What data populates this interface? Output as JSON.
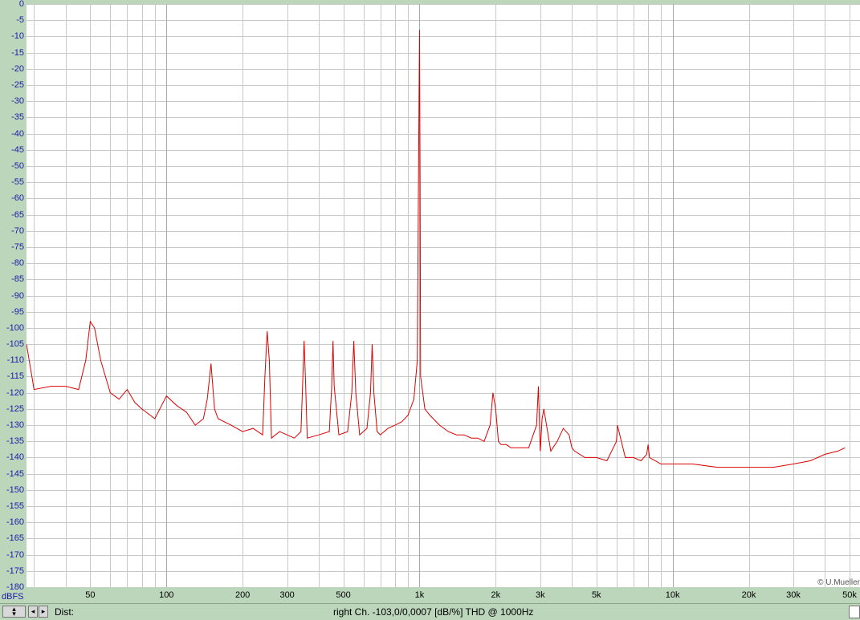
{
  "chart_data": {
    "type": "line",
    "title": "",
    "xlabel": "",
    "ylabel": "",
    "y_unit_label": "dBFS",
    "x_scale": "log",
    "xlim": [
      28,
      55000
    ],
    "ylim": [
      -180,
      0
    ],
    "grid": true,
    "y_ticks": [
      "0",
      "-5",
      "-10",
      "-15",
      "-20",
      "-25",
      "-30",
      "-35",
      "-40",
      "-45",
      "-50",
      "-55",
      "-60",
      "-65",
      "-70",
      "-75",
      "-80",
      "-85",
      "-90",
      "-95",
      "-100",
      "-105",
      "-110",
      "-115",
      "-120",
      "-125",
      "-130",
      "-135",
      "-140",
      "-145",
      "-150",
      "-155",
      "-160",
      "-165",
      "-170",
      "-175",
      "-180"
    ],
    "x_tick_labels": [
      {
        "value": 50,
        "label": "50"
      },
      {
        "value": 100,
        "label": "100"
      },
      {
        "value": 200,
        "label": "200"
      },
      {
        "value": 300,
        "label": "300"
      },
      {
        "value": 500,
        "label": "500"
      },
      {
        "value": 1000,
        "label": "1k"
      },
      {
        "value": 2000,
        "label": "2k"
      },
      {
        "value": 3000,
        "label": "3k"
      },
      {
        "value": 5000,
        "label": "5k"
      },
      {
        "value": 10000,
        "label": "10k"
      },
      {
        "value": 20000,
        "label": "20k"
      },
      {
        "value": 30000,
        "label": "30k"
      },
      {
        "value": 50000,
        "label": "50k"
      }
    ],
    "series": [
      {
        "color": "#dd0000",
        "x": [
          28,
          30,
          35,
          40,
          45,
          48,
          50,
          52,
          55,
          60,
          65,
          70,
          75,
          80,
          90,
          100,
          110,
          120,
          130,
          140,
          145,
          150,
          155,
          160,
          180,
          200,
          220,
          240,
          245,
          250,
          255,
          260,
          280,
          300,
          320,
          340,
          345,
          350,
          355,
          360,
          400,
          440,
          450,
          455,
          460,
          480,
          520,
          540,
          550,
          560,
          580,
          620,
          640,
          650,
          660,
          680,
          700,
          750,
          800,
          850,
          900,
          950,
          980,
          1000,
          1005,
          1010,
          1030,
          1050,
          1100,
          1200,
          1300,
          1400,
          1500,
          1600,
          1700,
          1800,
          1900,
          1950,
          2000,
          2050,
          2100,
          2200,
          2300,
          2500,
          2700,
          2900,
          2950,
          3000,
          3050,
          3100,
          3300,
          3500,
          3700,
          3900,
          4000,
          4100,
          4500,
          5000,
          5500,
          6000,
          6050,
          6500,
          7000,
          7500,
          7900,
          8000,
          8100,
          9000,
          10000,
          12000,
          15000,
          20000,
          25000,
          30000,
          35000,
          40000,
          45000,
          48000
        ],
        "y": [
          -105,
          -119,
          -118,
          -118,
          -119,
          -110,
          -98,
          -100,
          -110,
          -120,
          -122,
          -119,
          -123,
          -125,
          -128,
          -121,
          -124,
          -126,
          -130,
          -128,
          -122,
          -111,
          -125,
          -128,
          -130,
          -132,
          -131,
          -133,
          -115,
          -101,
          -110,
          -134,
          -132,
          -133,
          -134,
          -132,
          -118,
          -104,
          -118,
          -134,
          -133,
          -132,
          -118,
          -104,
          -118,
          -133,
          -132,
          -120,
          -104,
          -120,
          -133,
          -131,
          -120,
          -105,
          -120,
          -132,
          -133,
          -131,
          -130,
          -129,
          -127,
          -122,
          -110,
          -8,
          -50,
          -115,
          -120,
          -125,
          -127,
          -130,
          -132,
          -133,
          -133,
          -134,
          -134,
          -135,
          -130,
          -120,
          -125,
          -135,
          -136,
          -136,
          -137,
          -137,
          -137,
          -130,
          -118,
          -138,
          -128,
          -125,
          -138,
          -135,
          -131,
          -133,
          -137,
          -138,
          -140,
          -140,
          -141,
          -135,
          -130,
          -140,
          -140,
          -141,
          -139,
          -136,
          -140,
          -142,
          -142,
          -142,
          -143,
          -143,
          -143,
          -142,
          -141,
          -139,
          -138,
          -137
        ]
      }
    ]
  },
  "copyright": "© U.Mueller",
  "status": {
    "dist_label": "Dist:",
    "text": "right Ch. -103,0/0,0007 [dB/%] THD @ 1000Hz",
    "left_arrow": "◂",
    "right_arrow": "▸"
  }
}
